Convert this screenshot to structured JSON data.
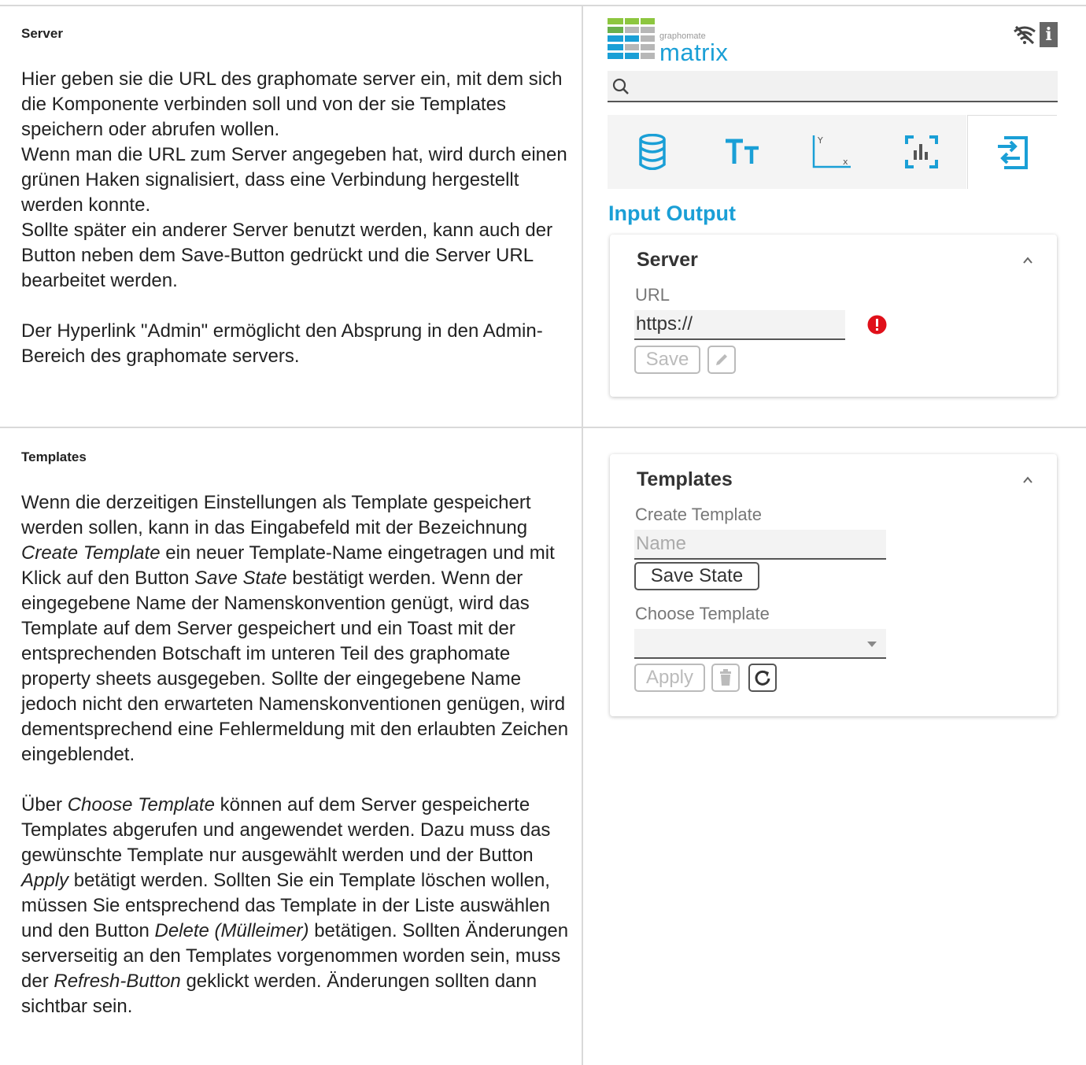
{
  "server_section": {
    "heading": "Server",
    "paragraphs": [
      "Hier geben sie die URL des graphomate server ein, mit dem sich die Komponente verbinden soll und von der sie Templates speichern oder abrufen wollen.",
      "Wenn man die URL zum Server angegeben hat, wird durch einen grünen Haken signalisiert, dass eine Verbindung hergestellt werden konnte.",
      "Sollte später ein anderer Server benutzt werden, kann auch der Button neben dem Save-Button gedrückt und die Server URL bearbeitet werden.",
      "Der Hyperlink \"Admin\" ermöglicht den Absprung in den Admin-Bereich des graphomate servers."
    ]
  },
  "templates_section": {
    "heading": "Templates",
    "p1": {
      "a": "Wenn die derzeitigen Einstellungen als Template gespeichert werden sollen, kann in das Eingabefeld mit der Bezeichnung ",
      "b": "Create Template",
      "c": " ein neuer Template-Name eingetragen und mit Klick auf den Button ",
      "d": "Save State",
      "e": " bestätigt werden. Wenn der eingegebene Name der Namenskonvention genügt, wird das Template auf dem Server gespeichert und ein Toast mit der entsprechenden Botschaft im unteren Teil des graphomate property sheets ausgegeben. Sollte der eingegebene Name jedoch nicht den erwarteten Namenskonventionen genügen, wird dementsprechend eine Fehlermeldung mit den erlaubten Zeichen eingeblendet."
    },
    "p2": {
      "a": "Über ",
      "b": "Choose Template",
      "c": " können auf dem Server gespeicherte Templates abgerufen und angewendet werden. Dazu muss das gewünschte Template nur ausgewählt werden und der Button ",
      "d": "Apply",
      "e": " betätigt werden. Sollten Sie ein Template löschen wollen, müssen Sie entsprechend das Template in der Liste auswählen und den Button ",
      "f": "Delete (Mülleimer)",
      "g": " betätigen. Sollten Änderungen serverseitig an den Templates vorgenommen worden sein, muss der ",
      "h": "Refresh-Button",
      "i": " geklickt werden. Änderungen sollten dann sichtbar sein."
    }
  },
  "panel": {
    "logo_small": "graphomate",
    "logo_big": "matrix",
    "info_label": "i",
    "section_title": "Input Output",
    "accent": "#1a9fd6",
    "error_color": "#e0101a",
    "icons": [
      "wifi-off-icon",
      "info-icon",
      "search-icon",
      "database-icon",
      "text-size-icon",
      "axis-icon",
      "chart-icon",
      "input-output-icon"
    ],
    "server_card": {
      "title": "Server",
      "url_label": "URL",
      "url_value": "https://",
      "save_label": "Save"
    },
    "templates_card": {
      "title": "Templates",
      "create_label": "Create Template",
      "name_placeholder": "Name",
      "save_state_label": "Save State",
      "choose_label": "Choose Template",
      "selected_value": "",
      "apply_label": "Apply"
    }
  }
}
